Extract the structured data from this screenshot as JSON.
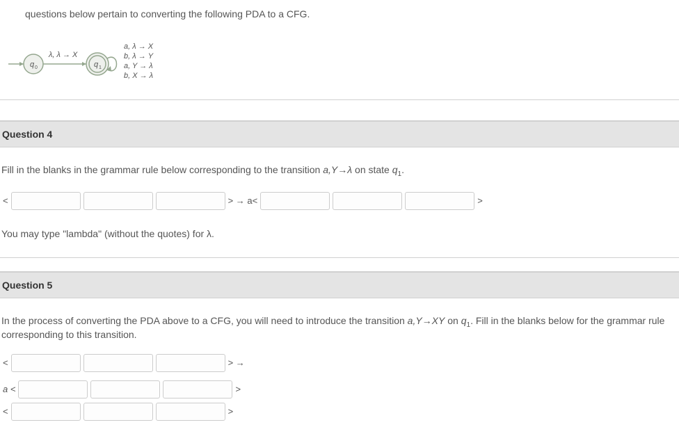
{
  "intro": {
    "text": "questions below pertain to converting the following PDA to a CFG."
  },
  "diagram": {
    "state0": "q",
    "state0_sub": "0",
    "state1": "q",
    "state1_sub": "1",
    "edge_label": "λ, λ → X",
    "loop1": "a, λ → X",
    "loop2": "b, λ → Y",
    "loop3": "a, Y → λ",
    "loop4": "b, X → λ"
  },
  "question4": {
    "header": "Question 4",
    "prompt_prefix": "Fill in the blanks in the grammar rule below corresponding to the transition ",
    "prompt_trans": "a,Y→λ",
    "prompt_mid": " on state ",
    "prompt_state": "q",
    "prompt_state_sub": "1",
    "prompt_suffix": ".",
    "sep1": "<",
    "sep2": "> → a<",
    "sep3": ">",
    "note": "You may type \"lambda\" (without the quotes) for λ."
  },
  "question5": {
    "header": "Question 5",
    "prompt_prefix": "In the process of converting the PDA above to a CFG, you will need to introduce the transition ",
    "prompt_trans": "a,Y→XY",
    "prompt_mid": " on ",
    "prompt_state": "q",
    "prompt_state_sub": "1",
    "prompt_suffix": ". Fill in the blanks below for the grammar rule corresponding to this transition.",
    "line1_sep1": "<",
    "line1_sep2": "> →",
    "line2_sep1": "a <",
    "line2_sep2": ">",
    "line3_sep1": "<",
    "line3_sep2": ">"
  }
}
